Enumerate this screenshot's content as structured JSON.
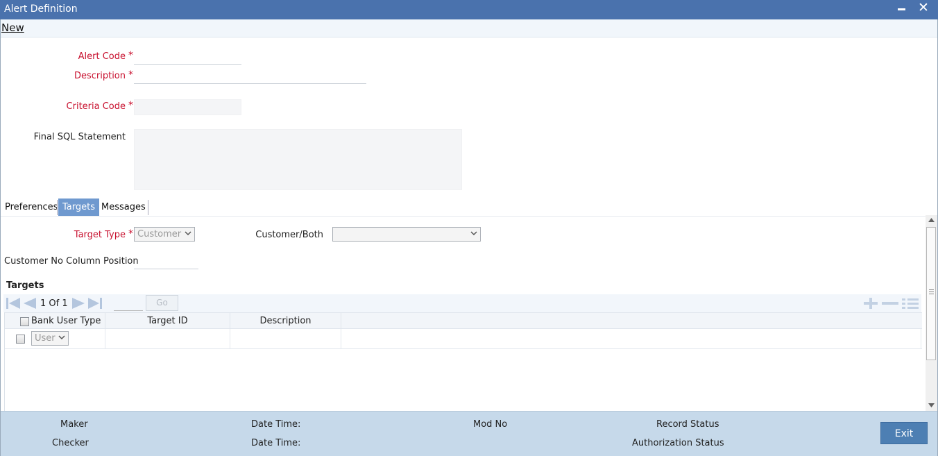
{
  "window": {
    "title": "Alert Definition",
    "minimize_icon": "minimize-icon",
    "close_icon": "close-icon"
  },
  "menu": {
    "new_label": "New"
  },
  "form": {
    "alert_code_label": "Alert Code",
    "description_label": "Description",
    "criteria_code_label": "Criteria Code",
    "final_sql_label": "Final SQL Statement",
    "required_mark": "*"
  },
  "tabs": [
    {
      "label": "Preferences",
      "active": false
    },
    {
      "label": "Targets",
      "active": true
    },
    {
      "label": "Messages",
      "active": false
    }
  ],
  "targets_tab": {
    "target_type_label": "Target Type",
    "target_type_value": "Customer",
    "customer_both_label": "Customer/Both",
    "customer_both_value": "",
    "customer_no_col_label": "Customer No Column Position",
    "section_title": "Targets",
    "pager": {
      "current": "1",
      "of_label": "Of",
      "total": "1",
      "go_label": "Go"
    },
    "columns": [
      "Bank User Type",
      "Target ID",
      "Description"
    ],
    "rows": [
      {
        "bank_user_type": "User",
        "target_id": "",
        "description": ""
      }
    ]
  },
  "footer": {
    "maker_label": "Maker",
    "checker_label": "Checker",
    "date_time_label": "Date Time:",
    "mod_no_label": "Mod No",
    "record_status_label": "Record Status",
    "auth_status_label": "Authorization Status",
    "exit_label": "Exit"
  },
  "colors": {
    "titlebar": "#4a72ad",
    "required": "#c8102e",
    "active_tab": "#6f99cf",
    "footer": "#c6d9ea",
    "exit_button": "#4d7fb3"
  }
}
